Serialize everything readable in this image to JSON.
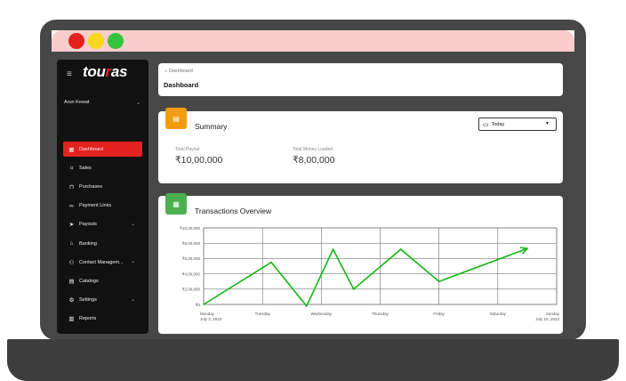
{
  "window": {
    "controls": [
      "close",
      "minimize",
      "maximize"
    ]
  },
  "sidebar": {
    "logo": {
      "text_before": "tou",
      "text_accent": "r",
      "text_after": "as"
    },
    "user": {
      "name": "Arun Kewat"
    },
    "items": [
      {
        "label": "Dashboard",
        "icon": "grid-icon",
        "glyph": "▦",
        "active": true
      },
      {
        "label": "Sales",
        "icon": "tag-icon",
        "glyph": "⌑"
      },
      {
        "label": "Purchases",
        "icon": "shopping-bag-icon",
        "glyph": "⊓"
      },
      {
        "label": "Payment Links",
        "icon": "link-icon",
        "glyph": "∞"
      },
      {
        "label": "Payouts",
        "icon": "send-icon",
        "glyph": "➤",
        "expandable": true
      },
      {
        "label": "Banking",
        "icon": "bank-icon",
        "glyph": "⌂"
      },
      {
        "label": "Contact Managem...",
        "icon": "people-icon",
        "glyph": "⚇",
        "expandable": true
      },
      {
        "label": "Catalogs",
        "icon": "book-icon",
        "glyph": "▤"
      },
      {
        "label": "Settings",
        "icon": "gear-icon",
        "glyph": "⚙",
        "expandable": true
      },
      {
        "label": "Reports",
        "icon": "report-icon",
        "glyph": "▥"
      }
    ]
  },
  "header": {
    "breadcrumb": "Dashboard",
    "title": "Dashboard"
  },
  "summary": {
    "title": "Summary",
    "date_filter": "Today",
    "stats": [
      {
        "label": "Total Payout",
        "value": "₹10,00,000"
      },
      {
        "label": "Total Money Loaded",
        "value": "₹8,00,000"
      }
    ]
  },
  "colors": {
    "accent": "#e3211f",
    "summary_badge": "#f39c12",
    "overview_badge": "#4caf50",
    "line": "#14b814"
  },
  "chart_data": {
    "type": "line",
    "title": "Transactions Overview",
    "categories": [
      "Monday",
      "Tuesday",
      "Wednesday",
      "Thursday",
      "Friday",
      "Saturday",
      "Sunday"
    ],
    "x_sublabels": {
      "Monday": "July 3, 2023",
      "Sunday": "July 10, 2023"
    },
    "y_tick_labels": [
      "₹0",
      "₹2,00,000",
      "₹4,00,000",
      "₹6,00,000",
      "₹8,00,000",
      "₹10,00,000"
    ],
    "ylim": [
      0,
      1000000
    ],
    "grid": true,
    "x": [
      0,
      1.15,
      1.75,
      2.2,
      2.55,
      3.35,
      4.0,
      5.5
    ],
    "y": [
      0,
      550000,
      -20000,
      720000,
      200000,
      720000,
      300000,
      730000
    ],
    "end_arrow": true
  }
}
